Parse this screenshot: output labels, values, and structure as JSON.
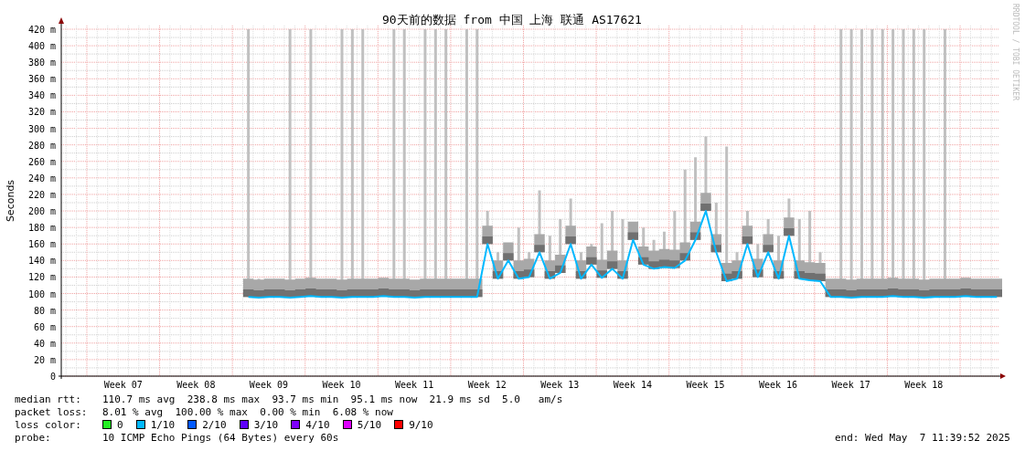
{
  "graph": {
    "title": "90天前的数据 from 中国 上海 联通 AS17621",
    "ylabel": "Seconds",
    "credit": "RRDTOOL / TOBI OETIKER",
    "y_ticks": [
      "420 m",
      "400 m",
      "380 m",
      "360 m",
      "340 m",
      "320 m",
      "300 m",
      "280 m",
      "260 m",
      "240 m",
      "220 m",
      "200 m",
      "180 m",
      "160 m",
      "140 m",
      "120 m",
      "100 m",
      "80 m",
      "60 m",
      "40 m",
      "20 m",
      "0"
    ],
    "x_ticks": [
      "Week 07",
      "Week 08",
      "Week 09",
      "Week 10",
      "Week 11",
      "Week 12",
      "Week 13",
      "Week 14",
      "Week 15",
      "Week 16",
      "Week 17",
      "Week 18"
    ]
  },
  "legend": [
    {
      "kind": "text",
      "label": "median rtt:",
      "value": "110.7 ms avg  238.8 ms max  93.7 ms min  95.1 ms now  21.9 ms sd  5.0   am/s"
    },
    {
      "kind": "text",
      "label": "packet loss:",
      "value": "8.01 % avg  100.00 % max  0.00 % min  6.08 % now"
    },
    {
      "kind": "colors",
      "label": "loss color:",
      "items": [
        {
          "label": "0",
          "color": "#22ee22"
        },
        {
          "label": "1/10",
          "color": "#00b8ff"
        },
        {
          "label": "2/10",
          "color": "#0059ff"
        },
        {
          "label": "3/10",
          "color": "#5e00ff"
        },
        {
          "label": "4/10",
          "color": "#7e00ff"
        },
        {
          "label": "5/10",
          "color": "#dd00ff"
        },
        {
          "label": "9/10",
          "color": "#ff0000"
        }
      ]
    },
    {
      "kind": "probe",
      "label": "probe:",
      "value": "10 ICMP Echo Pings (64 Bytes) every 60s",
      "end": "end: Wed May  7 11:39:52 2025"
    }
  ]
}
